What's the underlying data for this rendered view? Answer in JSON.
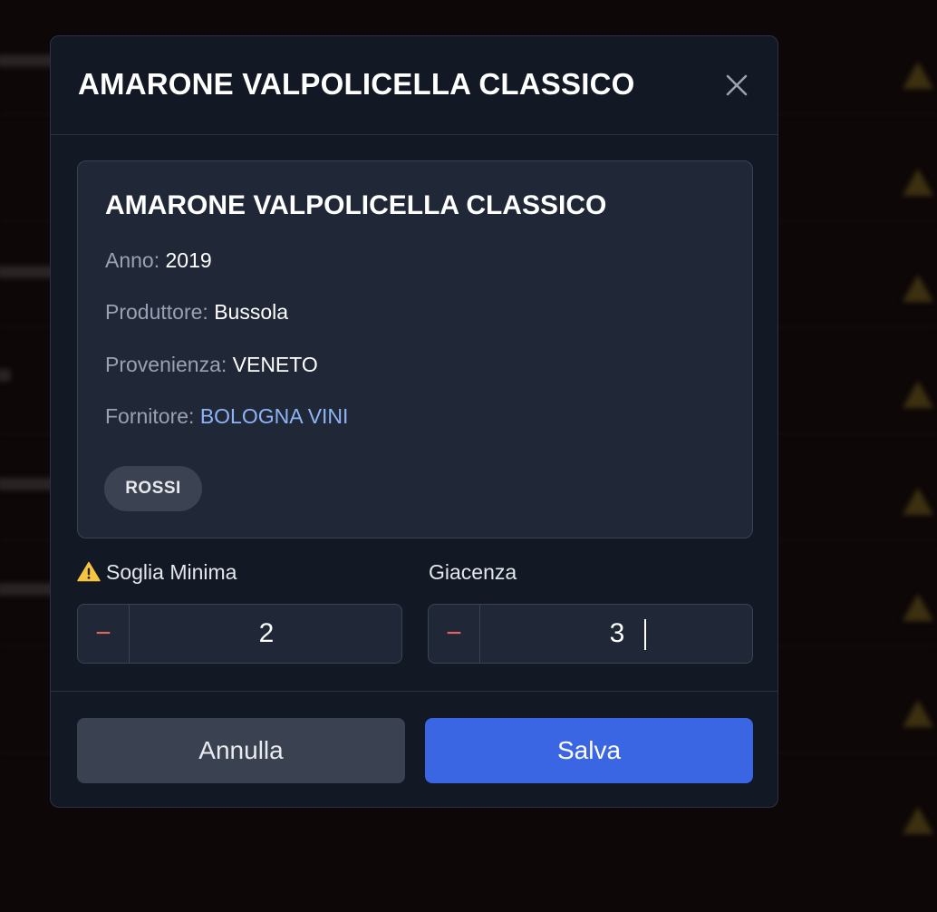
{
  "modal": {
    "title": "AMARONE VALPOLICELLA CLASSICO",
    "close_icon": "close-icon"
  },
  "wine": {
    "name": "AMARONE VALPOLICELLA CLASSICO",
    "year_label": "Anno:",
    "year": "2019",
    "producer_label": "Produttore:",
    "producer": "Bussola",
    "origin_label": "Provenienza:",
    "origin": "VENETO",
    "supplier_label": "Fornitore:",
    "supplier": "BOLOGNA VINI",
    "category": "ROSSI"
  },
  "min_threshold": {
    "icon": "warning-icon",
    "label": "Soglia Minima",
    "decrement_symbol": "−",
    "value": "2"
  },
  "stock": {
    "label": "Giacenza",
    "decrement_symbol": "−",
    "value": "3"
  },
  "buttons": {
    "cancel": "Annulla",
    "save": "Salva"
  },
  "colors": {
    "accent": "#3b66e3",
    "supplier_link": "#8fb4f5",
    "decrement": "#e0655f",
    "warning": "#f5c542"
  }
}
